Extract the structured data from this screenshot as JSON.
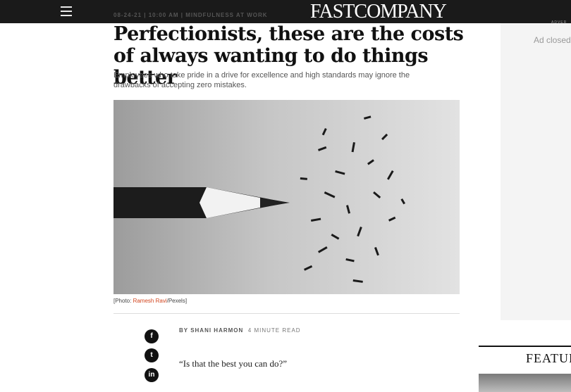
{
  "header": {
    "logo": "FASTCOMPANY"
  },
  "article": {
    "meta": "08-24-21 | 10:00 AM | MINDFULNESS AT WORK",
    "headline": "Perfectionists, these are the costs of always wanting to do things better",
    "dek": "Employees who take pride in a drive for excellence and high standards may ignore the drawbacks of accepting zero mistakes.",
    "caption_prefix": "[Photo: ",
    "caption_credit": "Ramesh Ravi",
    "caption_suffix": "/Pexels]",
    "byline_label": "BY SHANI HARMON",
    "read_time": "4 MINUTE READ",
    "first_line": "“Is that the best you can do?”"
  },
  "share": {
    "facebook": "f",
    "twitter": "t",
    "linkedin": "in"
  },
  "sidebar": {
    "ad_label": "ADVER",
    "ad_closed": "Ad closed",
    "features_heading": "FEATURE"
  },
  "colors": {
    "accent": "#d2451e",
    "topbar": "#1a1a1a"
  }
}
